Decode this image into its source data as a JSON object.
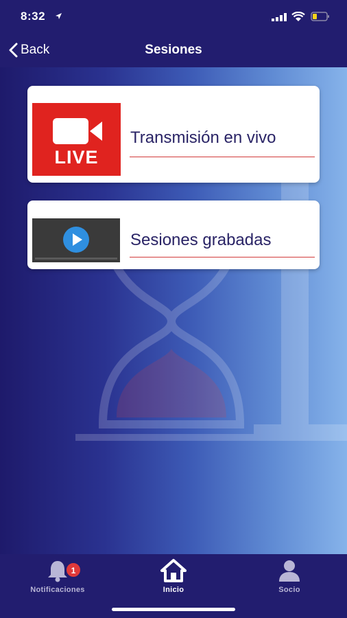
{
  "status": {
    "time": "8:32",
    "icons": [
      "location-arrow-icon",
      "signal-icon",
      "wifi-icon",
      "battery-icon"
    ],
    "battery_color": "#f3d21b"
  },
  "nav": {
    "back_label": "Back",
    "title": "Sesiones"
  },
  "cards": [
    {
      "title": "Transmisión en vivo",
      "thumb_text": "LIVE",
      "thumb_color": "#e0231f",
      "icon": "video-camera-icon"
    },
    {
      "title": "Sesiones grabadas",
      "icon": "play-icon",
      "thumb_color": "#3a3a3a",
      "play_color": "#2f8fe0"
    }
  ],
  "tabbar": {
    "items": [
      {
        "label": "Notificaciones",
        "icon": "bell-icon",
        "badge": "1",
        "active": false
      },
      {
        "label": "Inicio",
        "icon": "home-icon",
        "active": true
      },
      {
        "label": "Socio",
        "icon": "person-icon",
        "active": false
      }
    ]
  },
  "colors": {
    "bar_background": "#221d6f",
    "accent_red": "#e0393a",
    "title_text": "#2a2466"
  }
}
